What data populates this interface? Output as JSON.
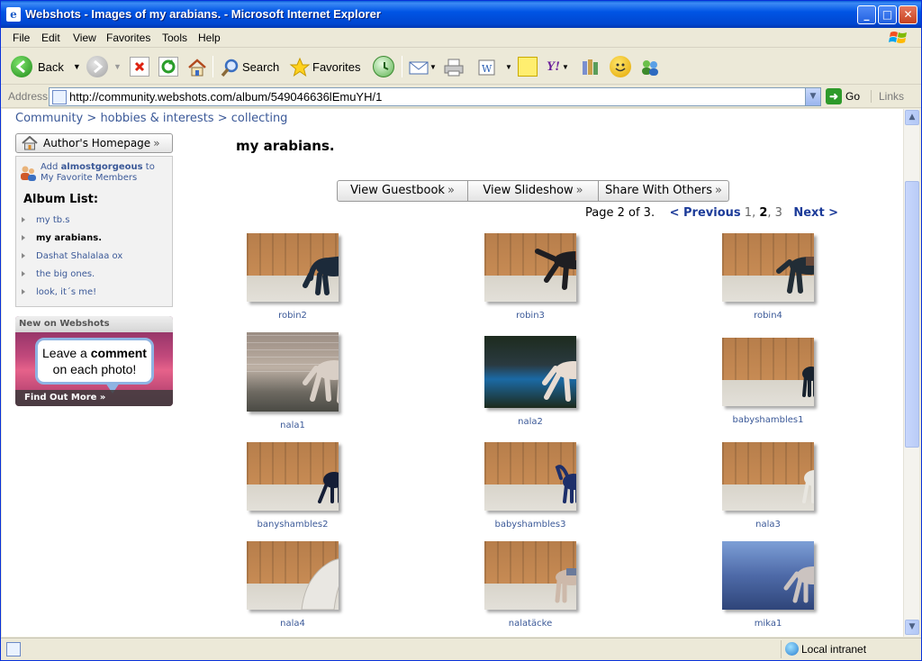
{
  "window": {
    "title": "Webshots - Images of my arabians. - Microsoft Internet Explorer"
  },
  "menu": [
    "File",
    "Edit",
    "View",
    "Favorites",
    "Tools",
    "Help"
  ],
  "toolbar": {
    "back": "Back",
    "search": "Search",
    "favorites": "Favorites"
  },
  "address": {
    "label": "Address",
    "url": "http://community.webshots.com/album/549046636lEmuYH/1",
    "go": "Go",
    "links": "Links"
  },
  "breadcrumb": {
    "community": "Community",
    "sep": ">",
    "hobbies": "hobbies & interests",
    "collecting": "collecting"
  },
  "sidebar": {
    "author_homepage": "Author's Homepage",
    "add_prefix": "Add",
    "add_user": "almostgorgeous",
    "add_suffix": "to My Favorite Members",
    "album_list_title": "Album List:",
    "albums": [
      {
        "label": "my tb.s",
        "current": false
      },
      {
        "label": "my arabians.",
        "current": true
      },
      {
        "label": "Dashat Shalalaa ox",
        "current": false
      },
      {
        "label": "the big ones.",
        "current": false
      },
      {
        "label": "look, it´s me!",
        "current": false
      }
    ],
    "promo": {
      "header": "New on Webshots",
      "line1_a": "Leave a",
      "line1_b": "comment",
      "line2": "on each photo!",
      "footer": "Find Out More »"
    }
  },
  "main": {
    "album_title": "my arabians.",
    "buttons": [
      "View Guestbook",
      "View Slideshow",
      "Share With Others"
    ],
    "pager": {
      "status": "Page 2 of 3.",
      "previous": "< Previous",
      "p1": "1",
      "p2": "2",
      "p3": "3",
      "next": "Next >"
    },
    "photos": [
      {
        "caption": "robin2"
      },
      {
        "caption": "robin3"
      },
      {
        "caption": "robin4"
      },
      {
        "caption": "nala1"
      },
      {
        "caption": "nala2"
      },
      {
        "caption": "babyshambles1"
      },
      {
        "caption": "banyshambles2"
      },
      {
        "caption": "babyshambles3"
      },
      {
        "caption": "nala3"
      },
      {
        "caption": "nala4"
      },
      {
        "caption": "nalatäcke"
      },
      {
        "caption": "mika1"
      }
    ]
  },
  "status": {
    "zone": "Local intranet"
  }
}
